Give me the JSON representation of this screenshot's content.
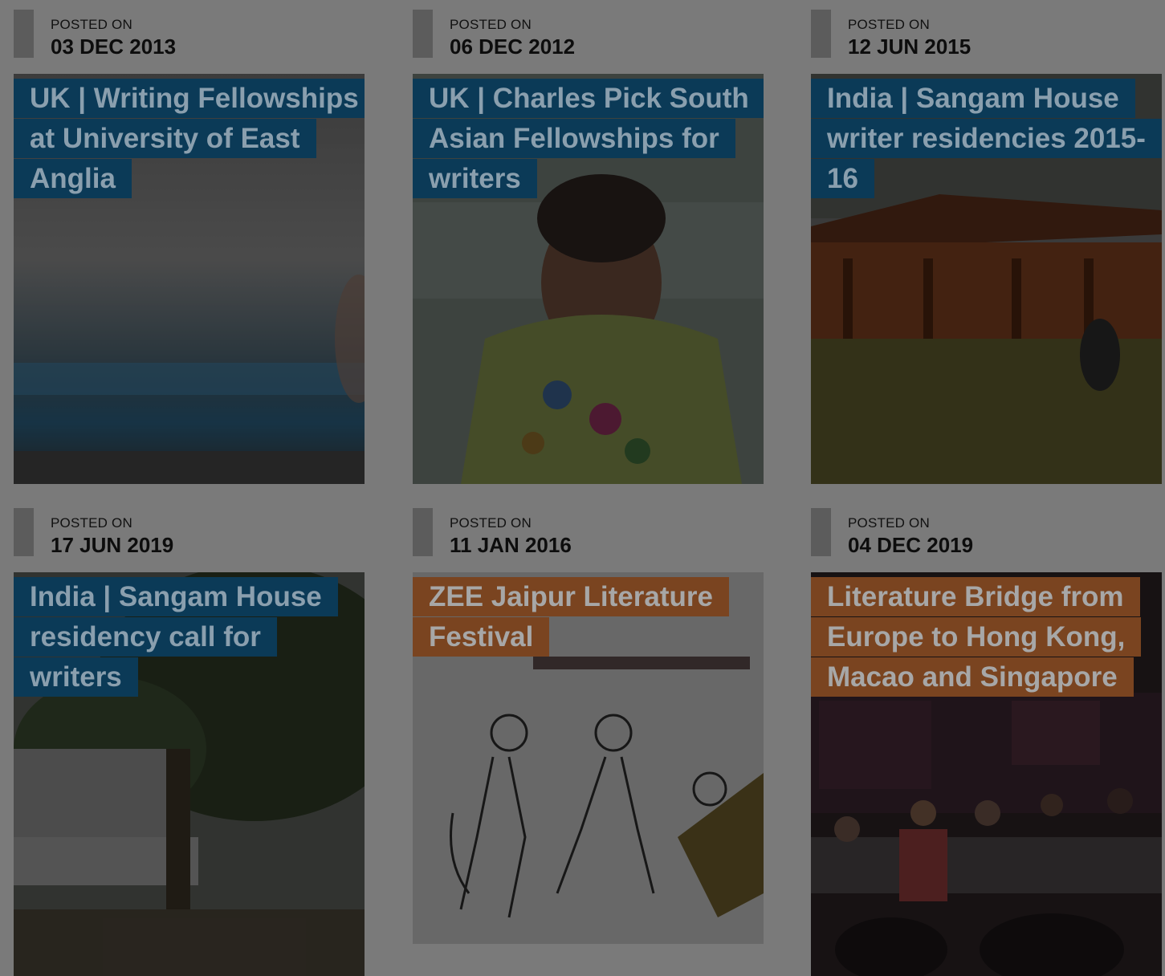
{
  "posts": [
    {
      "posted_label": "POSTED ON",
      "date": "03 DEC 2013",
      "title": "UK | Writing Fellowships at University of East Anglia",
      "label_color": "#0b3a57"
    },
    {
      "posted_label": "POSTED ON",
      "date": "06 DEC 2012",
      "title": "UK | Charles Pick South Asian Fellowships for writers",
      "label_color": "#0b3a57"
    },
    {
      "posted_label": "POSTED ON",
      "date": "12 JUN 2015",
      "title": "India | Sangam House writer residencies 2015-16",
      "label_color": "#0b3a57"
    },
    {
      "posted_label": "POSTED ON",
      "date": "17 JUN 2019",
      "title": "India | Sangam House residency call for writers",
      "label_color": "#0b3a57"
    },
    {
      "posted_label": "POSTED ON",
      "date": "11 JAN 2016",
      "title": "ZEE Jaipur Literature Festival",
      "label_color": "#7a4420"
    },
    {
      "posted_label": "POSTED ON",
      "date": "04 DEC 2019",
      "title": "Literature Bridge from Europe to Hong Kong, Macao and Singapore",
      "label_color": "#7a4420"
    }
  ]
}
